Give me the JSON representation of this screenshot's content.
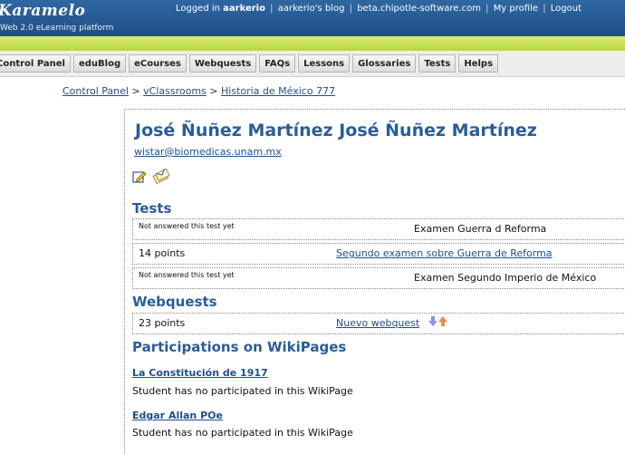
{
  "header": {
    "logo": "Karamelo",
    "tagline": "Web 2.0 eLearning platform",
    "logged_prefix": "Logged in",
    "username": "aarkerio",
    "links": [
      "aarkerio's blog",
      "beta.chipotle-software.com",
      "My profile",
      "Logout"
    ]
  },
  "nav": {
    "tabs": [
      "Control Panel",
      "eduBlog",
      "eCourses",
      "Webquests",
      "FAQs",
      "Lessons",
      "Glossaries",
      "Tests",
      "Helps"
    ]
  },
  "breadcrumb": {
    "items": [
      "Control Panel",
      "vClassrooms",
      "Historia de México 777"
    ],
    "separator": ">"
  },
  "student": {
    "name": "José Ñuñez Martínez José Ñuñez Martínez",
    "email": "wistar@biomedicas.unam.mx",
    "icons": [
      "edit-icon",
      "envelope-icon"
    ]
  },
  "tests": {
    "heading": "Tests",
    "rows": [
      {
        "status": "Not answered this test yet",
        "title": "Examen Guerra d Reforma"
      },
      {
        "status": "14 points",
        "title": "Segundo examen sobre Guerra de Reforma"
      },
      {
        "status": "Not answered this test yet",
        "title": "Examen Segundo Imperio de México"
      }
    ]
  },
  "webquests": {
    "heading": "Webquests",
    "rows": [
      {
        "status": "23 points",
        "title": "Nuevo webquest",
        "icons": [
          "arrow-down-icon",
          "arrow-up-icon"
        ]
      }
    ]
  },
  "wiki": {
    "heading": "Participations on WikiPages",
    "items": [
      {
        "title": "La Constitución de 1917",
        "note": "Student has no participated in this WikiPage"
      },
      {
        "title": "Edgar Allan POe",
        "note": "Student has no participated in this WikiPage"
      }
    ]
  },
  "colors": {
    "header_blue": "#2f67a3",
    "accent_green": "#c6e05a",
    "heading_blue": "#2a5d9a",
    "link_blue": "#1e4f8f"
  }
}
